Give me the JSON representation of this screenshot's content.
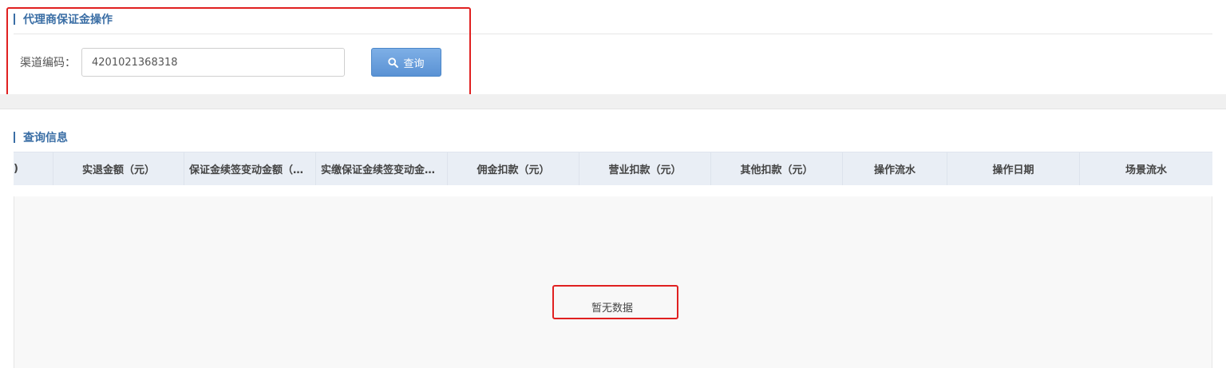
{
  "operation_section": {
    "title": "代理商保证金操作",
    "channel_code_label": "渠道编码：",
    "channel_code_value": "4201021368318",
    "query_button_label": "查询",
    "query_icon": "search-icon"
  },
  "info_section": {
    "title": "查询信息",
    "columns": [
      ")",
      "实退金额（元）",
      "保证金续签变动金额（元）",
      "实缴保证金续签变动金额（元）",
      "佣金扣款（元）",
      "营业扣款（元）",
      "其他扣款（元）",
      "操作流水",
      "操作日期",
      "场景流水"
    ],
    "empty_text": "暂无数据"
  },
  "colors": {
    "title_blue": "#3a6ea5",
    "button_blue": "#5a92d4",
    "highlight_red": "#e02020",
    "header_bg": "#e9eef5"
  }
}
